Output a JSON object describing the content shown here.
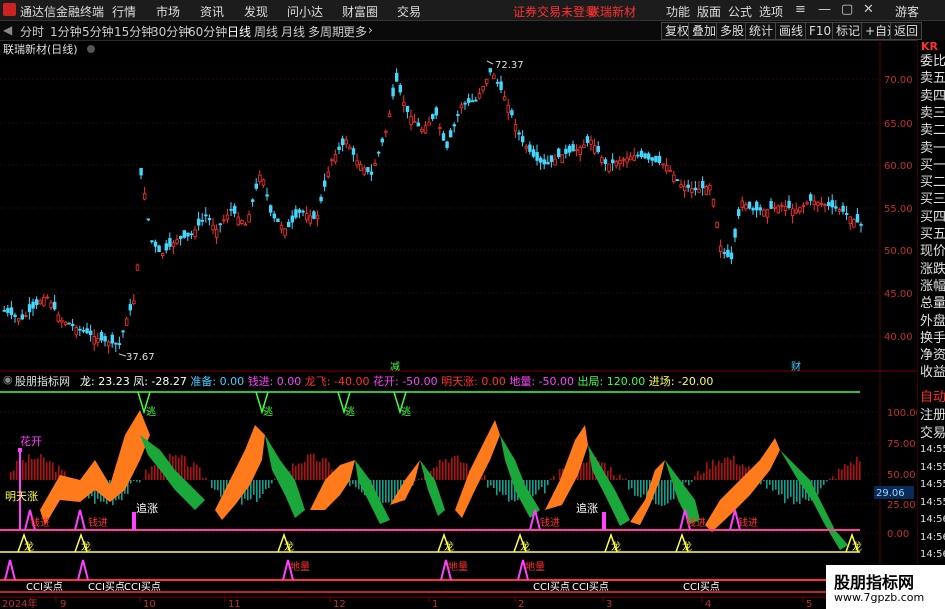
{
  "titlebar": {
    "app_title": "通达信金融终端",
    "menus": [
      "行情",
      "市场",
      "资讯",
      "发现",
      "问小达",
      "财富圈",
      "交易"
    ],
    "notice": "证券交易未登录",
    "stock_name": "联瑞新材",
    "right_menus": [
      "功能",
      "版面",
      "公式",
      "选项"
    ],
    "user": "游客"
  },
  "periodbar": {
    "periods": [
      "分时",
      "1分钟",
      "5分钟",
      "15分钟",
      "30分钟",
      "60分钟",
      "日线",
      "周线",
      "月线",
      "多周期",
      "更多"
    ],
    "active": "日线",
    "tools": [
      "复权",
      "叠加",
      "多股",
      "统计",
      "画线",
      "F10",
      "标记",
      "+自选",
      "返回"
    ]
  },
  "main_chart": {
    "title": "联瑞新材(日线)",
    "y_ticks": [
      "70.00",
      "65.00",
      "60.00",
      "55.00",
      "50.00",
      "45.00",
      "40.00"
    ],
    "high_label": "72.37",
    "low_label": "37.67",
    "marker_jian": "减",
    "marker_cai": "财"
  },
  "indicator": {
    "name": "股朋指标网",
    "values": [
      {
        "label": "龙: 23.23",
        "color": "#ffffff"
      },
      {
        "label": "凤: -28.27",
        "color": "#ffffff"
      },
      {
        "label": "准备: 0.00",
        "color": "#3ad0ff"
      },
      {
        "label": "钱进: 0.00",
        "color": "#ff40ff"
      },
      {
        "label": "龙飞: -40.00",
        "color": "#ff3030"
      },
      {
        "label": "花开: -50.00",
        "color": "#ff40ff"
      },
      {
        "label": "明天涨: 0.00",
        "color": "#ff3030"
      },
      {
        "label": "地量: -50.00",
        "color": "#ff40ff"
      },
      {
        "label": "出局: 120.00",
        "color": "#40ff40"
      },
      {
        "label": "进场: -20.00",
        "color": "#ffff40"
      }
    ],
    "y_ticks": [
      "100.00",
      "75.00",
      "50.00",
      "25.00",
      "0.00"
    ],
    "current_value": "29.06",
    "labels": {
      "huakai": "花开",
      "mingtian": "明天涨",
      "zhuizhang1": "追涨",
      "zhuizhang2": "追涨",
      "qianjin": "钱进",
      "long": "龙",
      "diliang": "地量",
      "cci": "CCI买点",
      "tao": "逃"
    }
  },
  "x_axis": [
    "2024年",
    "9",
    "10",
    "11",
    "12",
    "1",
    "2",
    "3",
    "4",
    "5"
  ],
  "side_panel": {
    "code": "KR",
    "items": [
      "委比",
      "卖五",
      "卖四",
      "卖三",
      "卖二",
      "卖一",
      "买一",
      "买二",
      "买三",
      "买四",
      "买五",
      "现价",
      "涨跌",
      "涨幅",
      "总量",
      "外盘",
      "换手",
      "净资",
      "收益"
    ],
    "lower_items": [
      "自动",
      "注册",
      "交易"
    ],
    "times": [
      "14:55",
      "14:55",
      "14:55",
      "14:55",
      "14:56",
      "14:56",
      "14:56",
      "14:56",
      "14:56"
    ]
  },
  "watermark": {
    "brand": "股朋指标网",
    "url": "www.7gpzb.com"
  }
}
